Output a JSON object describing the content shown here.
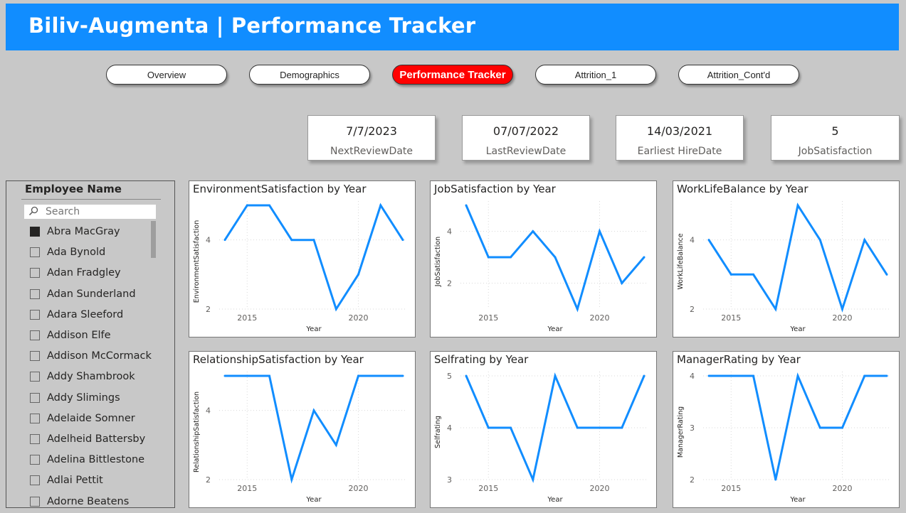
{
  "header": {
    "title": "Biliv-Augmenta | Performance Tracker"
  },
  "nav": {
    "buttons": [
      {
        "label": "Overview"
      },
      {
        "label": "Demographics"
      },
      {
        "label": "Performance Tracker",
        "active": true
      },
      {
        "label": "Attrition_1"
      },
      {
        "label": "Attrition_Cont'd"
      }
    ]
  },
  "cards": [
    {
      "value": "7/7/2023",
      "label": "NextReviewDate"
    },
    {
      "value": "07/07/2022",
      "label": "LastReviewDate"
    },
    {
      "value": "14/03/2021",
      "label": "Earliest HireDate"
    },
    {
      "value": "5",
      "label": "JobSatisfaction"
    }
  ],
  "slicer": {
    "title": "Employee Name",
    "search_placeholder": "Search",
    "items": [
      {
        "label": "Abra MacGray",
        "checked": true
      },
      {
        "label": "Ada Bynold",
        "checked": false
      },
      {
        "label": "Adan Fradgley",
        "checked": false
      },
      {
        "label": "Adan Sunderland",
        "checked": false
      },
      {
        "label": "Adara Sleeford",
        "checked": false
      },
      {
        "label": "Addison Elfe",
        "checked": false
      },
      {
        "label": "Addison McCormack",
        "checked": false
      },
      {
        "label": "Addy Shambrook",
        "checked": false
      },
      {
        "label": "Addy Slimings",
        "checked": false
      },
      {
        "label": "Adelaide Somner",
        "checked": false
      },
      {
        "label": "Adelheid Battersby",
        "checked": false
      },
      {
        "label": "Adelina Bittlestone",
        "checked": false
      },
      {
        "label": "Adlai Pettit",
        "checked": false
      },
      {
        "label": "Adorne Beatens",
        "checked": false
      }
    ]
  },
  "colors": {
    "line": "#118dff",
    "header": "#118dff",
    "active_button": "#ff0000"
  },
  "chart_data": [
    {
      "type": "line",
      "title": "EnvironmentSatisfaction by Year",
      "xlabel": "Year",
      "ylabel": "EnvironmentSatisfaction",
      "x": [
        2014,
        2015,
        2016,
        2017,
        2018,
        2019,
        2020,
        2021,
        2022
      ],
      "values": [
        4,
        5,
        5,
        4,
        4,
        2,
        3,
        5,
        4
      ],
      "xticks": [
        2015,
        2020
      ],
      "yticks": [
        2,
        4
      ],
      "ylim": [
        2,
        5
      ],
      "grid": true
    },
    {
      "type": "line",
      "title": "JobSatisfaction by Year",
      "xlabel": "Year",
      "ylabel": "JobSatisfaction",
      "x": [
        2014,
        2015,
        2016,
        2017,
        2018,
        2019,
        2020,
        2021,
        2022
      ],
      "values": [
        5,
        3,
        3,
        4,
        3,
        1,
        4,
        2,
        3
      ],
      "xticks": [
        2015,
        2020
      ],
      "yticks": [
        2,
        4
      ],
      "ylim": [
        1,
        5
      ],
      "grid": true
    },
    {
      "type": "line",
      "title": "WorkLifeBalance by Year",
      "xlabel": "Year",
      "ylabel": "WorkLifeBalance",
      "x": [
        2014,
        2015,
        2016,
        2017,
        2018,
        2019,
        2020,
        2021,
        2022
      ],
      "values": [
        4,
        3,
        3,
        2,
        5,
        4,
        2,
        4,
        3
      ],
      "xticks": [
        2015,
        2020
      ],
      "yticks": [
        2,
        4
      ],
      "ylim": [
        2,
        5
      ],
      "grid": true
    },
    {
      "type": "line",
      "title": "RelationshipSatisfaction by Year",
      "xlabel": "Year",
      "ylabel": "RelationshipSatisfaction",
      "x": [
        2014,
        2015,
        2016,
        2017,
        2018,
        2019,
        2020,
        2021,
        2022
      ],
      "values": [
        5,
        5,
        5,
        2,
        4,
        3,
        5,
        5,
        5
      ],
      "xticks": [
        2015,
        2020
      ],
      "yticks": [
        2,
        4
      ],
      "ylim": [
        2,
        5
      ],
      "grid": true
    },
    {
      "type": "line",
      "title": "Selfrating by Year",
      "xlabel": "Year",
      "ylabel": "Selfrating",
      "x": [
        2014,
        2015,
        2016,
        2017,
        2018,
        2019,
        2020,
        2021,
        2022
      ],
      "values": [
        5,
        4,
        4,
        3,
        5,
        4,
        4,
        4,
        5
      ],
      "xticks": [
        2015,
        2020
      ],
      "yticks": [
        3,
        4,
        5
      ],
      "ylim": [
        3,
        5
      ],
      "grid": true
    },
    {
      "type": "line",
      "title": "ManagerRating by Year",
      "xlabel": "Year",
      "ylabel": "ManagerRating",
      "x": [
        2014,
        2015,
        2016,
        2017,
        2018,
        2019,
        2020,
        2021,
        2022
      ],
      "values": [
        4,
        4,
        4,
        2,
        4,
        3,
        3,
        4,
        4
      ],
      "xticks": [
        2015,
        2020
      ],
      "yticks": [
        2,
        3,
        4
      ],
      "ylim": [
        2,
        4
      ],
      "grid": true
    }
  ]
}
